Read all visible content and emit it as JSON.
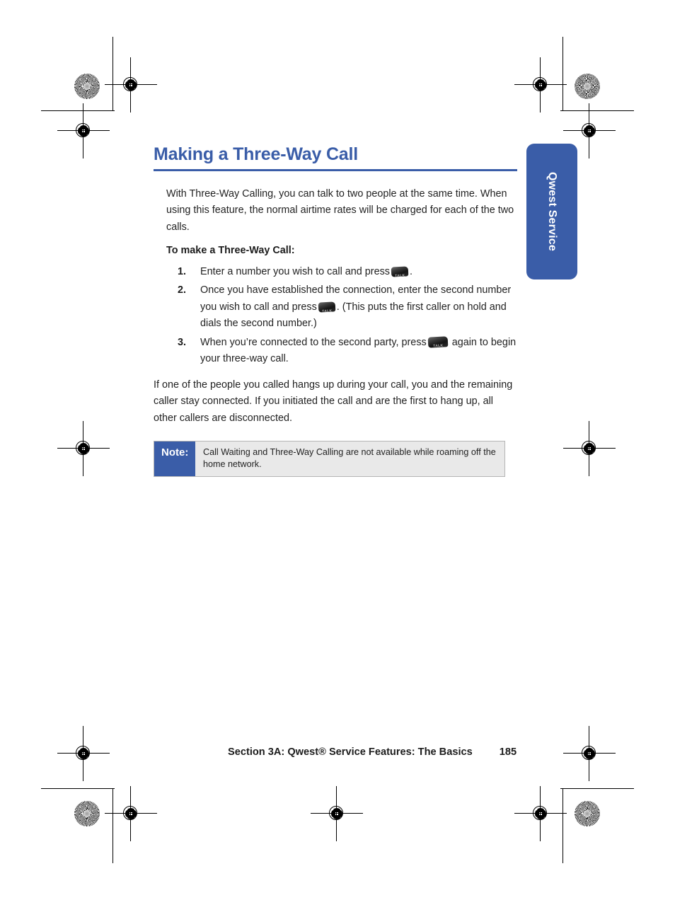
{
  "document": {
    "title": "Making a Three-Way Call",
    "intro": "With Three-Way Calling, you can talk to two people at the same time. When using this feature, the normal airtime rates will be charged for each of the two calls.",
    "lead_in": "To make a Three-Way Call:",
    "steps": [
      {
        "number": "1.",
        "text_before": "Enter a number you wish to call and press",
        "icon": "talk-key-icon",
        "text_after": "."
      },
      {
        "number": "2.",
        "text_before": "Once you have established the connection, enter the second number you wish to call and press",
        "icon": "talk-key-icon",
        "text_after": ". (This puts the first caller on hold and dials the second number.)"
      },
      {
        "number": "3.",
        "text_before": "When you’re connected to the second party, press",
        "icon": "talk-key-icon",
        "text_after": "again to begin your three-way call."
      }
    ],
    "closing": "If one of the people you called hangs up during your call, you and the remaining caller stay connected. If you initiated the call and are the first to hang up, all other callers are disconnected."
  },
  "note": {
    "label": "Note:",
    "text": "Call Waiting and Three-Way Calling are not available while roaming off the home network."
  },
  "side_tab": {
    "label": "Qwest Service"
  },
  "footer": {
    "section": "Section 3A: Qwest® Service Features: The Basics",
    "page_number": "185"
  },
  "colors": {
    "accent_blue": "#3a5da8",
    "note_body_bg": "#e9e9e9",
    "text": "#222222"
  },
  "print_marks": {
    "registration_icon": "registration-crosshair-icon",
    "star_icon": "star-density-target-icon"
  }
}
